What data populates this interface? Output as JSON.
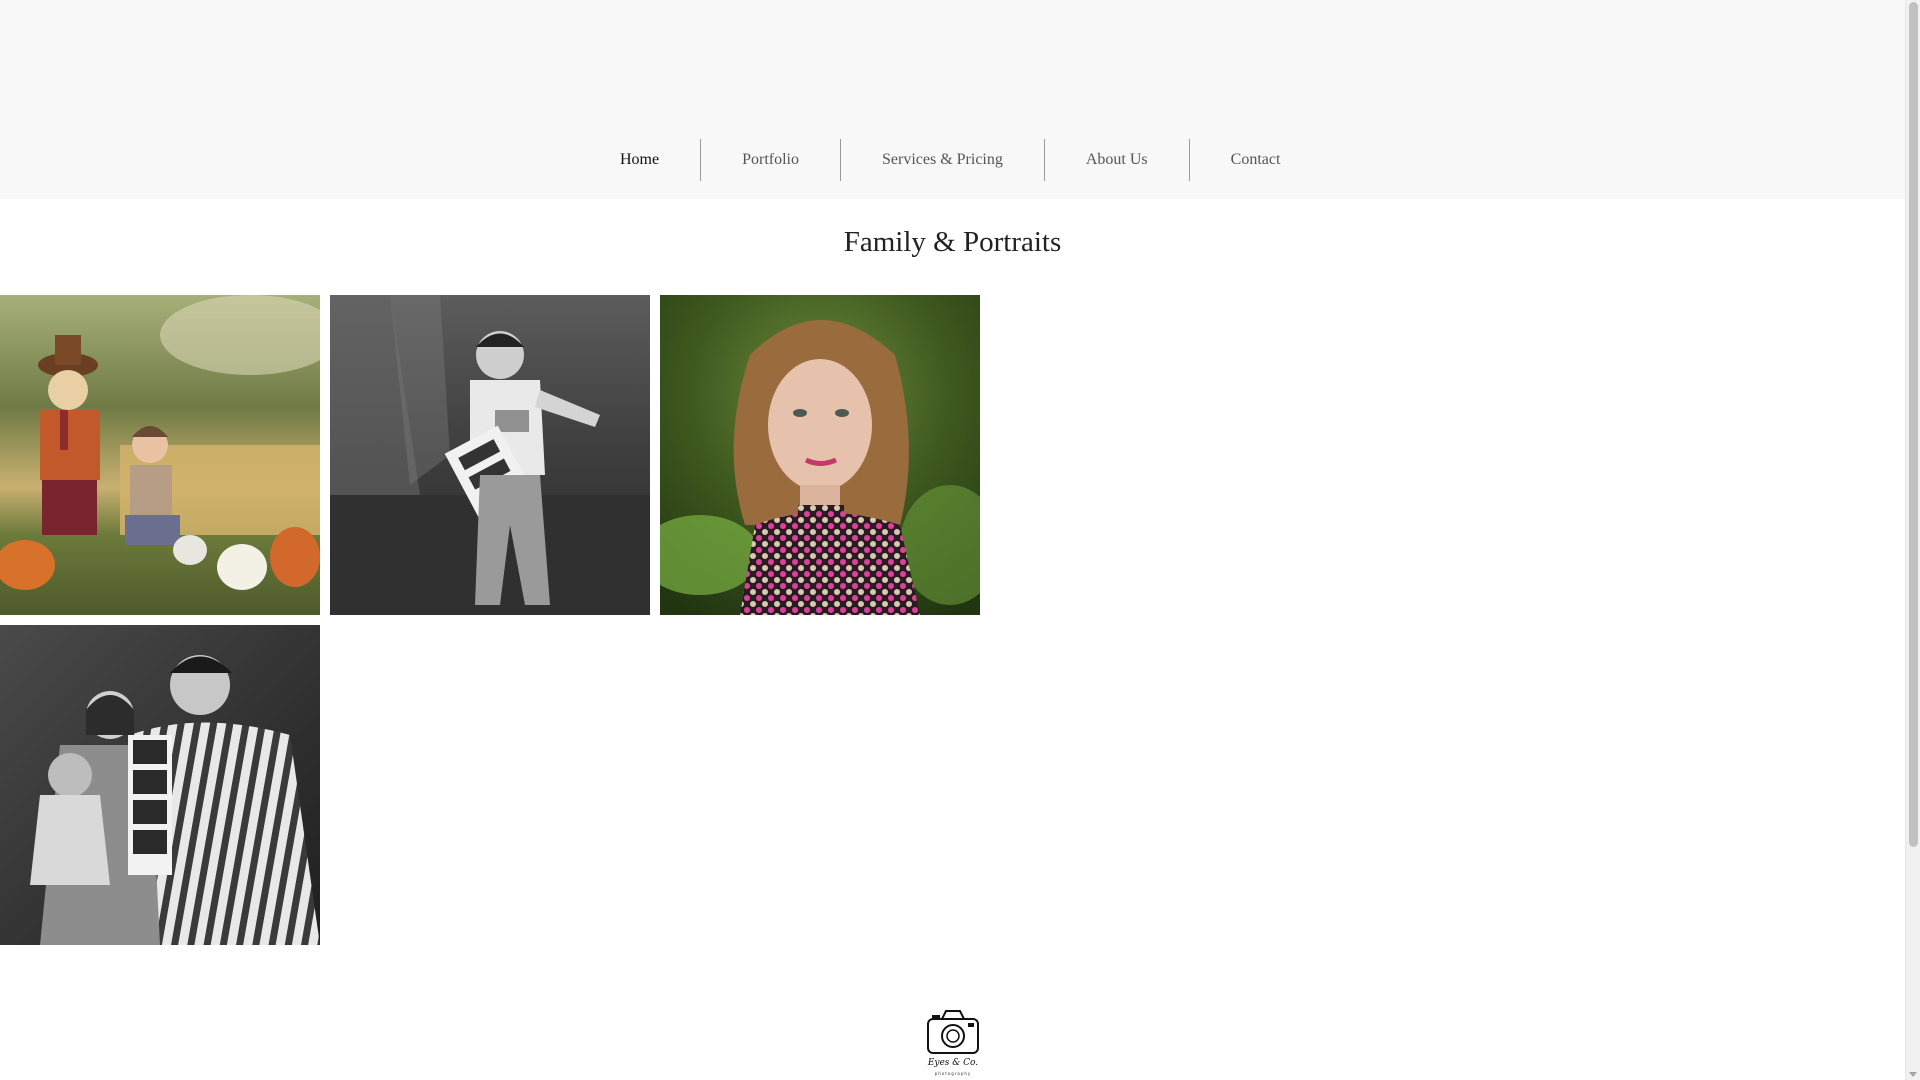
{
  "nav": {
    "items": [
      {
        "label": "Home",
        "active": true
      },
      {
        "label": "Portfolio",
        "active": false
      },
      {
        "label": "Services & Pricing",
        "active": false
      },
      {
        "label": "About Us",
        "active": false
      },
      {
        "label": "Contact",
        "active": false
      }
    ]
  },
  "page": {
    "title": "Family & Portraits"
  },
  "gallery": {
    "photos": [
      {
        "name": "scarecrow-toddler-photo"
      },
      {
        "name": "big-brother-boy-photo"
      },
      {
        "name": "woman-portrait-photo"
      },
      {
        "name": "family-ultrasound-photo"
      }
    ]
  },
  "footer": {
    "logo_text": "Eyes & Co.",
    "logo_subtext": "photography"
  },
  "colors": {
    "header_bg": "#f8f8f8",
    "page_bg": "#ffffff",
    "nav_text": "#555555",
    "nav_divider": "#9a9a9a"
  }
}
